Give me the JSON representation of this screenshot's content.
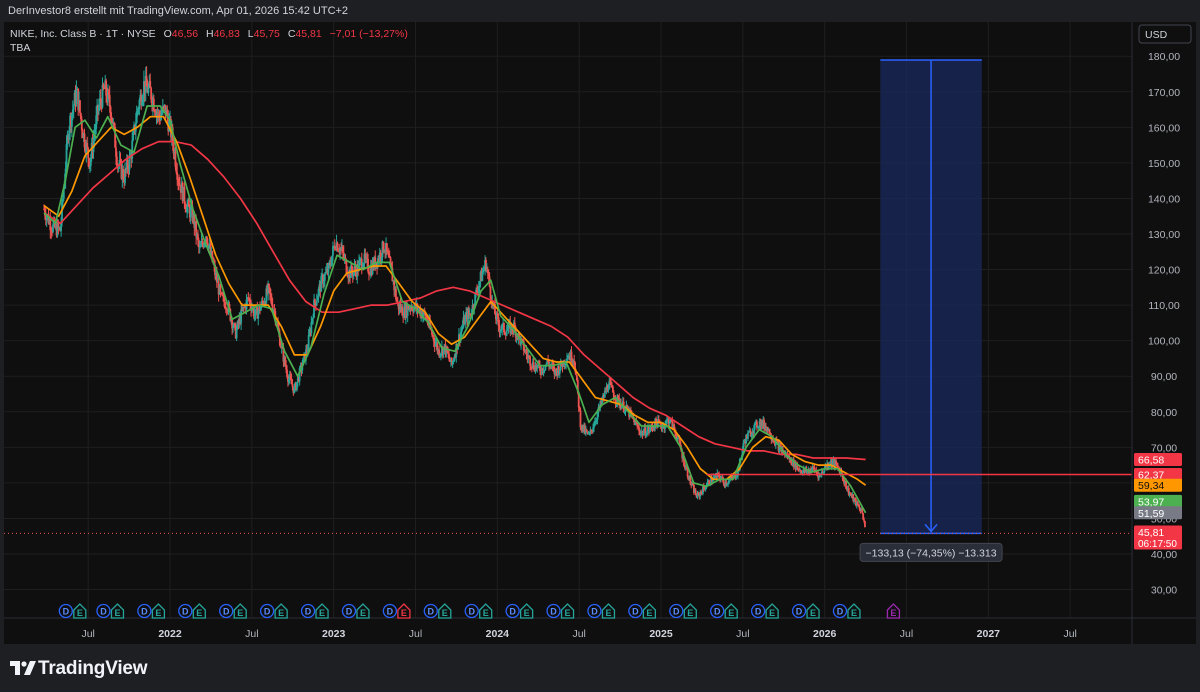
{
  "header": {
    "attribution": "DerInvestor8 erstellt mit TradingView.com, Apr 01, 2026 15:42 UTC+2"
  },
  "legend": {
    "symbol": "NIKE, Inc. Class B · 1T · NYSE",
    "o_label": "O",
    "o_value": "46,56",
    "h_label": "H",
    "h_value": "46,83",
    "l_label": "L",
    "l_value": "45,75",
    "c_label": "C",
    "c_value": "45,81",
    "change": "−7,01 (−13,27%)",
    "indicator": "TBA"
  },
  "currency_button": "USD",
  "colors": {
    "background": "#0f0f0f",
    "grid": "#1f1f1f",
    "up": "#26a69a",
    "down": "#ef5350",
    "ma_fast": "#4caf50",
    "ma_mid": "#ff9800",
    "ma_slow": "#f23645",
    "measure": "#2962ff",
    "measure_fill": "#1a2a5e",
    "earnings_e": "#7e57c2"
  },
  "measure_label": "−133,13 (−74,35%) −13.313",
  "footer": {
    "brand": "TradingView",
    "brand_icon": "tradingview-logo-icon"
  },
  "chart_data": {
    "type": "candlestick",
    "title": "NIKE, Inc. Class B · 1T · NYSE",
    "ylim": [
      22,
      184
    ],
    "y_ticks": [
      "30,00",
      "40,00",
      "50,00",
      "60,00",
      "70,00",
      "80,00",
      "90,00",
      "100,00",
      "110,00",
      "120,00",
      "130,00",
      "140,00",
      "150,00",
      "160,00",
      "170,00",
      "180,00"
    ],
    "x_ticks": [
      {
        "label": "Jul",
        "t": 2021.5,
        "bold": false
      },
      {
        "label": "2022",
        "t": 2022.0,
        "bold": true
      },
      {
        "label": "Jul",
        "t": 2022.5,
        "bold": false
      },
      {
        "label": "2023",
        "t": 2023.0,
        "bold": true
      },
      {
        "label": "Jul",
        "t": 2023.5,
        "bold": false
      },
      {
        "label": "2024",
        "t": 2024.0,
        "bold": true
      },
      {
        "label": "Jul",
        "t": 2024.5,
        "bold": false
      },
      {
        "label": "2025",
        "t": 2025.0,
        "bold": true
      },
      {
        "label": "Jul",
        "t": 2025.5,
        "bold": false
      },
      {
        "label": "2026",
        "t": 2026.0,
        "bold": true
      },
      {
        "label": "Jul",
        "t": 2026.5,
        "bold": false
      },
      {
        "label": "2027",
        "t": 2027.0,
        "bold": true
      },
      {
        "label": "Jul",
        "t": 2027.5,
        "bold": false
      }
    ],
    "x_range": [
      2021.23,
      2027.78
    ],
    "price_path": [
      [
        2021.23,
        137
      ],
      [
        2021.28,
        132
      ],
      [
        2021.33,
        131
      ],
      [
        2021.38,
        160
      ],
      [
        2021.43,
        170
      ],
      [
        2021.47,
        158
      ],
      [
        2021.51,
        150
      ],
      [
        2021.56,
        165
      ],
      [
        2021.6,
        171
      ],
      [
        2021.64,
        165
      ],
      [
        2021.68,
        150
      ],
      [
        2021.72,
        146
      ],
      [
        2021.76,
        152
      ],
      [
        2021.8,
        165
      ],
      [
        2021.84,
        172
      ],
      [
        2021.88,
        170
      ],
      [
        2021.93,
        163
      ],
      [
        2021.97,
        165
      ],
      [
        2022.01,
        158
      ],
      [
        2022.05,
        146
      ],
      [
        2022.1,
        138
      ],
      [
        2022.14,
        135
      ],
      [
        2022.18,
        125
      ],
      [
        2022.22,
        130
      ],
      [
        2022.27,
        120
      ],
      [
        2022.31,
        112
      ],
      [
        2022.35,
        110
      ],
      [
        2022.4,
        102
      ],
      [
        2022.44,
        108
      ],
      [
        2022.48,
        112
      ],
      [
        2022.52,
        107
      ],
      [
        2022.56,
        110
      ],
      [
        2022.6,
        114
      ],
      [
        2022.64,
        108
      ],
      [
        2022.68,
        98
      ],
      [
        2022.72,
        90
      ],
      [
        2022.76,
        86
      ],
      [
        2022.8,
        92
      ],
      [
        2022.84,
        98
      ],
      [
        2022.88,
        110
      ],
      [
        2022.93,
        117
      ],
      [
        2022.97,
        120
      ],
      [
        2023.01,
        128
      ],
      [
        2023.05,
        125
      ],
      [
        2023.09,
        119
      ],
      [
        2023.14,
        120
      ],
      [
        2023.18,
        123
      ],
      [
        2023.22,
        120
      ],
      [
        2023.27,
        123
      ],
      [
        2023.31,
        127
      ],
      [
        2023.35,
        120
      ],
      [
        2023.39,
        110
      ],
      [
        2023.43,
        108
      ],
      [
        2023.47,
        110
      ],
      [
        2023.51,
        109
      ],
      [
        2023.56,
        107
      ],
      [
        2023.6,
        102
      ],
      [
        2023.64,
        97
      ],
      [
        2023.68,
        98
      ],
      [
        2023.72,
        93
      ],
      [
        2023.76,
        100
      ],
      [
        2023.8,
        106
      ],
      [
        2023.84,
        108
      ],
      [
        2023.88,
        115
      ],
      [
        2023.93,
        122
      ],
      [
        2023.97,
        110
      ],
      [
        2024.01,
        104
      ],
      [
        2024.05,
        103
      ],
      [
        2024.1,
        104
      ],
      [
        2024.14,
        100
      ],
      [
        2024.18,
        96
      ],
      [
        2024.22,
        93
      ],
      [
        2024.27,
        92
      ],
      [
        2024.31,
        94
      ],
      [
        2024.35,
        91
      ],
      [
        2024.39,
        93
      ],
      [
        2024.43,
        96
      ],
      [
        2024.47,
        95
      ],
      [
        2024.51,
        76
      ],
      [
        2024.56,
        73
      ],
      [
        2024.6,
        78
      ],
      [
        2024.64,
        83
      ],
      [
        2024.68,
        88
      ],
      [
        2024.72,
        84
      ],
      [
        2024.76,
        82
      ],
      [
        2024.8,
        80
      ],
      [
        2024.84,
        77
      ],
      [
        2024.88,
        74
      ],
      [
        2024.93,
        75
      ],
      [
        2024.97,
        77
      ],
      [
        2025.01,
        76
      ],
      [
        2025.05,
        78
      ],
      [
        2025.1,
        73
      ],
      [
        2025.14,
        66
      ],
      [
        2025.18,
        60
      ],
      [
        2025.22,
        56
      ],
      [
        2025.27,
        59
      ],
      [
        2025.31,
        61
      ],
      [
        2025.35,
        62
      ],
      [
        2025.39,
        60
      ],
      [
        2025.43,
        61
      ],
      [
        2025.47,
        63
      ],
      [
        2025.51,
        72
      ],
      [
        2025.56,
        75
      ],
      [
        2025.6,
        77
      ],
      [
        2025.64,
        76
      ],
      [
        2025.68,
        73
      ],
      [
        2025.72,
        70
      ],
      [
        2025.76,
        68
      ],
      [
        2025.8,
        66
      ],
      [
        2025.84,
        64
      ],
      [
        2025.88,
        63
      ],
      [
        2025.93,
        64
      ],
      [
        2025.97,
        62
      ],
      [
        2026.01,
        65
      ],
      [
        2026.05,
        66
      ],
      [
        2026.1,
        63
      ],
      [
        2026.14,
        58
      ],
      [
        2026.18,
        55
      ],
      [
        2026.21,
        53
      ],
      [
        2026.23,
        52
      ],
      [
        2026.25,
        45.81
      ]
    ],
    "ma_fast": [
      [
        2021.23,
        136
      ],
      [
        2021.3,
        133
      ],
      [
        2021.36,
        145
      ],
      [
        2021.42,
        160
      ],
      [
        2021.48,
        162
      ],
      [
        2021.55,
        157
      ],
      [
        2021.62,
        163
      ],
      [
        2021.7,
        155
      ],
      [
        2021.78,
        153
      ],
      [
        2021.86,
        166
      ],
      [
        2021.94,
        166
      ],
      [
        2022.0,
        162
      ],
      [
        2022.06,
        150
      ],
      [
        2022.14,
        137
      ],
      [
        2022.22,
        127
      ],
      [
        2022.3,
        118
      ],
      [
        2022.38,
        106
      ],
      [
        2022.46,
        108
      ],
      [
        2022.54,
        110
      ],
      [
        2022.62,
        109
      ],
      [
        2022.7,
        97
      ],
      [
        2022.78,
        90
      ],
      [
        2022.86,
        98
      ],
      [
        2022.94,
        113
      ],
      [
        2023.02,
        124
      ],
      [
        2023.1,
        122
      ],
      [
        2023.18,
        120
      ],
      [
        2023.26,
        122
      ],
      [
        2023.34,
        122
      ],
      [
        2023.42,
        111
      ],
      [
        2023.5,
        109
      ],
      [
        2023.58,
        105
      ],
      [
        2023.66,
        98
      ],
      [
        2023.74,
        97
      ],
      [
        2023.82,
        104
      ],
      [
        2023.9,
        114
      ],
      [
        2023.96,
        117
      ],
      [
        2024.02,
        107
      ],
      [
        2024.1,
        103
      ],
      [
        2024.18,
        98
      ],
      [
        2024.26,
        93
      ],
      [
        2024.34,
        93
      ],
      [
        2024.42,
        94
      ],
      [
        2024.5,
        85
      ],
      [
        2024.56,
        77
      ],
      [
        2024.64,
        82
      ],
      [
        2024.72,
        84
      ],
      [
        2024.8,
        80
      ],
      [
        2024.88,
        76
      ],
      [
        2024.96,
        76
      ],
      [
        2025.04,
        76
      ],
      [
        2025.12,
        70
      ],
      [
        2025.2,
        60
      ],
      [
        2025.28,
        59
      ],
      [
        2025.36,
        61
      ],
      [
        2025.44,
        61
      ],
      [
        2025.52,
        70
      ],
      [
        2025.6,
        75
      ],
      [
        2025.68,
        73
      ],
      [
        2025.76,
        68
      ],
      [
        2025.84,
        65
      ],
      [
        2025.92,
        63
      ],
      [
        2026.0,
        64
      ],
      [
        2026.08,
        64
      ],
      [
        2026.16,
        59
      ],
      [
        2026.25,
        51.59
      ]
    ],
    "ma_mid": [
      [
        2021.23,
        138
      ],
      [
        2021.32,
        135
      ],
      [
        2021.4,
        142
      ],
      [
        2021.48,
        152
      ],
      [
        2021.56,
        156
      ],
      [
        2021.64,
        160
      ],
      [
        2021.72,
        158
      ],
      [
        2021.8,
        160
      ],
      [
        2021.88,
        163
      ],
      [
        2021.96,
        163
      ],
      [
        2022.04,
        156
      ],
      [
        2022.12,
        146
      ],
      [
        2022.2,
        135
      ],
      [
        2022.28,
        124
      ],
      [
        2022.36,
        116
      ],
      [
        2022.44,
        110
      ],
      [
        2022.52,
        110
      ],
      [
        2022.6,
        110
      ],
      [
        2022.68,
        104
      ],
      [
        2022.76,
        96
      ],
      [
        2022.84,
        96
      ],
      [
        2022.92,
        104
      ],
      [
        2023.0,
        114
      ],
      [
        2023.08,
        119
      ],
      [
        2023.16,
        120
      ],
      [
        2023.24,
        121
      ],
      [
        2023.32,
        121
      ],
      [
        2023.4,
        116
      ],
      [
        2023.48,
        111
      ],
      [
        2023.56,
        108
      ],
      [
        2023.64,
        102
      ],
      [
        2023.72,
        99
      ],
      [
        2023.8,
        101
      ],
      [
        2023.88,
        106
      ],
      [
        2023.96,
        111
      ],
      [
        2024.04,
        107
      ],
      [
        2024.12,
        103
      ],
      [
        2024.2,
        99
      ],
      [
        2024.28,
        95
      ],
      [
        2024.36,
        94
      ],
      [
        2024.44,
        94
      ],
      [
        2024.52,
        89
      ],
      [
        2024.6,
        84
      ],
      [
        2024.68,
        83
      ],
      [
        2024.76,
        82
      ],
      [
        2024.84,
        79
      ],
      [
        2024.92,
        77
      ],
      [
        2025.0,
        77
      ],
      [
        2025.08,
        75
      ],
      [
        2025.16,
        70
      ],
      [
        2025.24,
        64
      ],
      [
        2025.32,
        61
      ],
      [
        2025.4,
        61
      ],
      [
        2025.48,
        64
      ],
      [
        2025.56,
        70
      ],
      [
        2025.64,
        73
      ],
      [
        2025.72,
        72
      ],
      [
        2025.8,
        68
      ],
      [
        2025.88,
        66
      ],
      [
        2025.96,
        65
      ],
      [
        2026.04,
        65
      ],
      [
        2026.12,
        63
      ],
      [
        2026.2,
        61
      ],
      [
        2026.25,
        59.34
      ]
    ],
    "ma_slow": [
      [
        2021.23,
        136
      ],
      [
        2021.33,
        133
      ],
      [
        2021.43,
        138
      ],
      [
        2021.53,
        143
      ],
      [
        2021.63,
        147
      ],
      [
        2021.73,
        151
      ],
      [
        2021.83,
        154
      ],
      [
        2021.93,
        156
      ],
      [
        2022.03,
        156
      ],
      [
        2022.13,
        155
      ],
      [
        2022.23,
        151
      ],
      [
        2022.33,
        146
      ],
      [
        2022.43,
        140
      ],
      [
        2022.53,
        133
      ],
      [
        2022.63,
        125
      ],
      [
        2022.73,
        117
      ],
      [
        2022.83,
        111
      ],
      [
        2022.93,
        108
      ],
      [
        2023.03,
        108
      ],
      [
        2023.13,
        109
      ],
      [
        2023.23,
        110
      ],
      [
        2023.33,
        110
      ],
      [
        2023.43,
        111
      ],
      [
        2023.53,
        112
      ],
      [
        2023.63,
        114
      ],
      [
        2023.73,
        115
      ],
      [
        2023.83,
        114
      ],
      [
        2023.93,
        112
      ],
      [
        2024.03,
        110
      ],
      [
        2024.13,
        108
      ],
      [
        2024.23,
        106
      ],
      [
        2024.33,
        104
      ],
      [
        2024.43,
        101
      ],
      [
        2024.53,
        96
      ],
      [
        2024.63,
        92
      ],
      [
        2024.73,
        88
      ],
      [
        2024.83,
        84
      ],
      [
        2024.93,
        81
      ],
      [
        2025.03,
        79
      ],
      [
        2025.13,
        76
      ],
      [
        2025.23,
        73
      ],
      [
        2025.33,
        71
      ],
      [
        2025.43,
        70
      ],
      [
        2025.53,
        69
      ],
      [
        2025.63,
        69
      ],
      [
        2025.73,
        68
      ],
      [
        2025.83,
        68
      ],
      [
        2025.93,
        67
      ],
      [
        2026.03,
        67
      ],
      [
        2026.13,
        67
      ],
      [
        2026.25,
        66.58
      ]
    ],
    "hline": {
      "value": 62.37
    },
    "last_price": {
      "value": 45.81
    },
    "measure": {
      "t_start": 2026.34,
      "t_end": 2026.96,
      "top": 178.94,
      "bottom": 45.81
    },
    "price_labels": [
      {
        "text": "66,58",
        "value": 66.58,
        "bg": "#f23645",
        "fg": "#ffffff"
      },
      {
        "text": "62,37",
        "value": 62.37,
        "bg": "#f23645",
        "fg": "#ffffff"
      },
      {
        "text": "59,34",
        "value": 59.34,
        "bg": "#ff9800",
        "fg": "#0f0f0f"
      },
      {
        "text": "53,97",
        "value": 54.8,
        "bg": "#4caf50",
        "fg": "#ffffff"
      },
      {
        "text": "51,59",
        "value": 51.59,
        "bg": "#787b86",
        "fg": "#ffffff"
      },
      {
        "text": "45,81",
        "value": 46.2,
        "bg": "#f23645",
        "fg": "#ffffff",
        "sub": "06:17:50"
      }
    ],
    "events": [
      {
        "t": 2021.4,
        "d": "D",
        "e": "E",
        "e_color": "#26a69a"
      },
      {
        "t": 2021.63,
        "d": "D",
        "e": "E",
        "e_color": "#26a69a"
      },
      {
        "t": 2021.88,
        "d": "D",
        "e": "E",
        "e_color": "#26a69a"
      },
      {
        "t": 2022.13,
        "d": "D",
        "e": "E",
        "e_color": "#26a69a"
      },
      {
        "t": 2022.38,
        "d": "D",
        "e": "E",
        "e_color": "#26a69a"
      },
      {
        "t": 2022.63,
        "d": "D",
        "e": "E",
        "e_color": "#26a69a"
      },
      {
        "t": 2022.88,
        "d": "D",
        "e": "E",
        "e_color": "#26a69a"
      },
      {
        "t": 2023.13,
        "d": "D",
        "e": "E",
        "e_color": "#26a69a"
      },
      {
        "t": 2023.38,
        "d": "D",
        "e": "E",
        "e_color": "#f23645"
      },
      {
        "t": 2023.63,
        "d": "D",
        "e": "E",
        "e_color": "#26a69a"
      },
      {
        "t": 2023.88,
        "d": "D",
        "e": "E",
        "e_color": "#26a69a"
      },
      {
        "t": 2024.13,
        "d": "D",
        "e": "E",
        "e_color": "#26a69a"
      },
      {
        "t": 2024.38,
        "d": "D",
        "e": "E",
        "e_color": "#26a69a"
      },
      {
        "t": 2024.63,
        "d": "D",
        "e": "E",
        "e_color": "#26a69a"
      },
      {
        "t": 2024.88,
        "d": "D",
        "e": "E",
        "e_color": "#26a69a"
      },
      {
        "t": 2025.13,
        "d": "D",
        "e": "E",
        "e_color": "#26a69a"
      },
      {
        "t": 2025.38,
        "d": "D",
        "e": "E",
        "e_color": "#26a69a"
      },
      {
        "t": 2025.63,
        "d": "D",
        "e": "E",
        "e_color": "#26a69a"
      },
      {
        "t": 2025.88,
        "d": "D",
        "e": "E",
        "e_color": "#26a69a"
      },
      {
        "t": 2026.13,
        "d": "D",
        "e": "E",
        "e_color": "#26a69a"
      },
      {
        "t": 2026.42,
        "d": "",
        "e": "E",
        "e_color": "#9c27b0"
      }
    ]
  }
}
